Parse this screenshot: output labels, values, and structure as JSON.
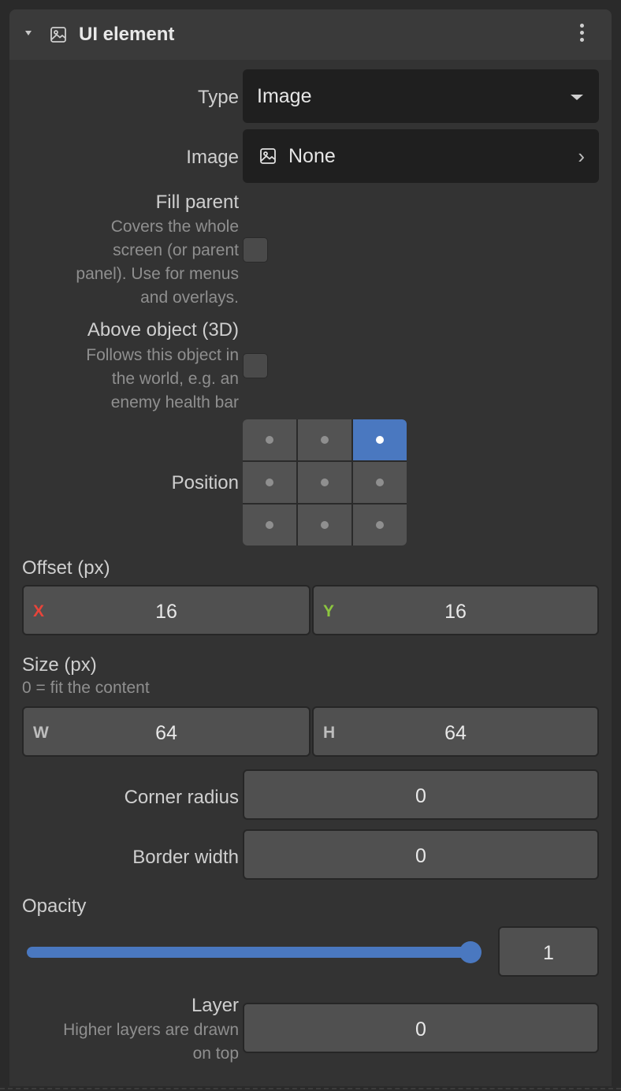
{
  "header": {
    "title": "UI element",
    "collapse_icon": "triangle-down-icon",
    "icon": "image-icon",
    "menu_icon": "kebab-icon"
  },
  "type": {
    "label": "Type",
    "value": "Image"
  },
  "image": {
    "label": "Image",
    "value": "None"
  },
  "fill_parent": {
    "label": "Fill parent",
    "desc": [
      "Covers the whole",
      "screen (or parent",
      "panel). Use for menus",
      "and overlays."
    ],
    "checked": false
  },
  "above_object": {
    "label": "Above object (3D)",
    "desc": [
      "Follows this object in",
      "the world, e.g. an",
      "enemy health bar"
    ],
    "checked": false
  },
  "position": {
    "label": "Position",
    "selected": "top-right"
  },
  "offset": {
    "label": "Offset (px)",
    "x_label": "X",
    "x_value": "16",
    "y_label": "Y",
    "y_value": "16"
  },
  "size": {
    "label": "Size (px)",
    "hint": "0 = fit the content",
    "w_label": "W",
    "w_value": "64",
    "h_label": "H",
    "h_value": "64"
  },
  "corner_radius": {
    "label": "Corner radius",
    "value": "0"
  },
  "border_width": {
    "label": "Border width",
    "value": "0"
  },
  "opacity": {
    "label": "Opacity",
    "value": "1",
    "slider_fraction": 1.0
  },
  "layer": {
    "label": "Layer",
    "desc": [
      "Higher layers are drawn",
      "on top"
    ],
    "value": "0"
  },
  "colors": {
    "accent": "#4a78c0",
    "x_axis": "#e8443a",
    "y_axis": "#8cc63f",
    "neutral_axis": "#bdbdbd"
  }
}
